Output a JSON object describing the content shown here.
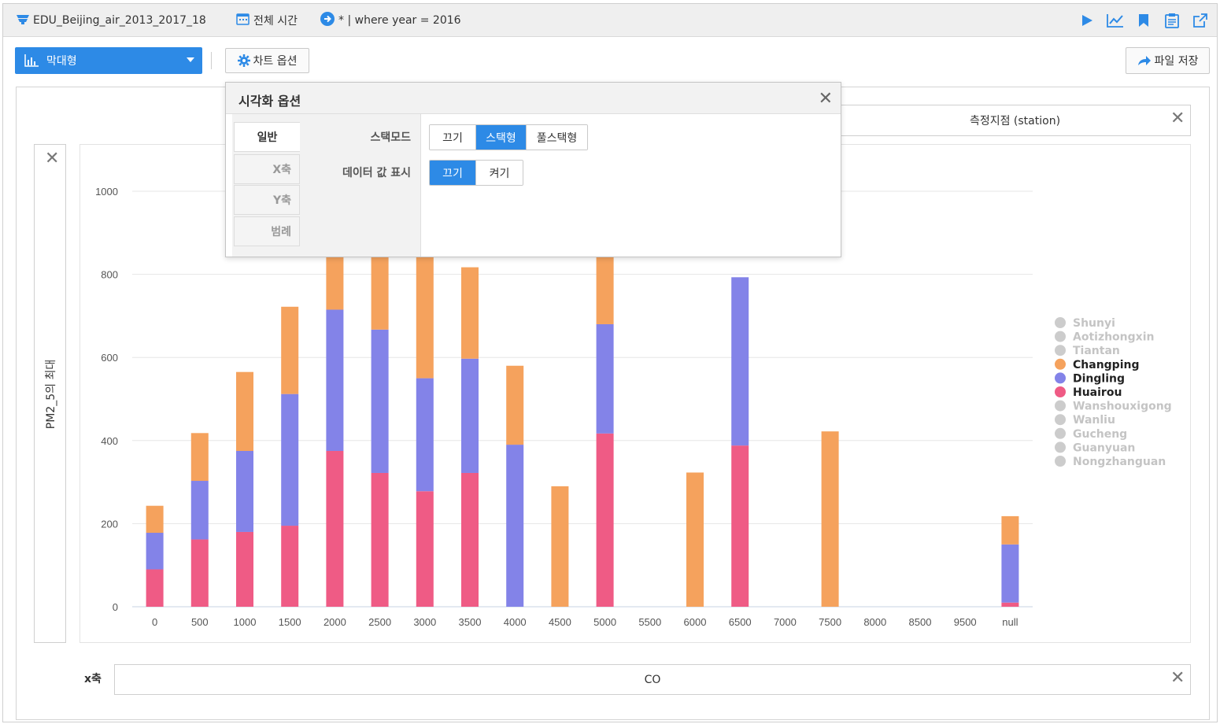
{
  "topbar": {
    "dataset": "EDU_Beijing_air_2013_2017_18",
    "time_range": "전체 시간",
    "filter": "* | where year = 2016",
    "icons": [
      "play-icon",
      "line-chart-icon",
      "bookmark-icon",
      "clipboard-icon",
      "external-link-icon"
    ]
  },
  "toolbar": {
    "chart_type": "막대형",
    "chart_options": "차트 옵션",
    "save_file": "파일 저장"
  },
  "shelves": {
    "column": "측정지점 (station)",
    "y": "PM2_5의 최대",
    "x_label": "x축",
    "x": "CO"
  },
  "popup": {
    "title": "시각화 옵션",
    "tabs": [
      "일반",
      "X축",
      "Y축",
      "범례"
    ],
    "stack_mode_label": "스택모드",
    "stack_modes": [
      "끄기",
      "스택형",
      "풀스택형"
    ],
    "stack_mode_selected": "스택형",
    "data_labels_label": "데이터 값 표시",
    "data_labels_modes": [
      "끄기",
      "켜기"
    ],
    "data_labels_selected": "끄기"
  },
  "colors": {
    "accent": "#2d8ae6",
    "Changping": "#f5a25d",
    "Dingling": "#8383e8",
    "Huairou": "#ef5b85",
    "disabled": "#cccccc"
  },
  "chart_data": {
    "type": "bar",
    "stacked": true,
    "categories": [
      "0",
      "500",
      "1000",
      "1500",
      "2000",
      "2500",
      "3000",
      "3500",
      "4000",
      "4500",
      "5000",
      "5500",
      "6000",
      "6500",
      "7000",
      "7500",
      "8000",
      "8500",
      "9500",
      "null"
    ],
    "series": [
      {
        "name": "Huairou",
        "values": [
          90,
          162,
          180,
          195,
          375,
          322,
          278,
          322,
          0,
          0,
          417,
          0,
          0,
          388,
          0,
          0,
          0,
          0,
          0,
          10
        ]
      },
      {
        "name": "Dingling",
        "values": [
          88,
          141,
          195,
          317,
          340,
          345,
          272,
          275,
          390,
          0,
          263,
          0,
          0,
          405,
          0,
          0,
          0,
          0,
          0,
          140
        ]
      },
      {
        "name": "Changping",
        "values": [
          65,
          115,
          190,
          210,
          250,
          250,
          300,
          220,
          190,
          290,
          250,
          0,
          323,
          0,
          0,
          422,
          0,
          0,
          0,
          68
        ]
      }
    ],
    "legend": [
      {
        "name": "Shunyi",
        "active": false
      },
      {
        "name": "Aotizhongxin",
        "active": false
      },
      {
        "name": "Tiantan",
        "active": false
      },
      {
        "name": "Changping",
        "active": true
      },
      {
        "name": "Dingling",
        "active": true
      },
      {
        "name": "Huairou",
        "active": true
      },
      {
        "name": "Wanshouxigong",
        "active": false
      },
      {
        "name": "Wanliu",
        "active": false
      },
      {
        "name": "Gucheng",
        "active": false
      },
      {
        "name": "Guanyuan",
        "active": false
      },
      {
        "name": "Nongzhanguan",
        "active": false
      }
    ],
    "ylim": [
      0,
      1000
    ],
    "yticks": [
      0,
      200,
      400,
      600,
      800,
      1000
    ],
    "legend_position": "right",
    "grid": true
  }
}
